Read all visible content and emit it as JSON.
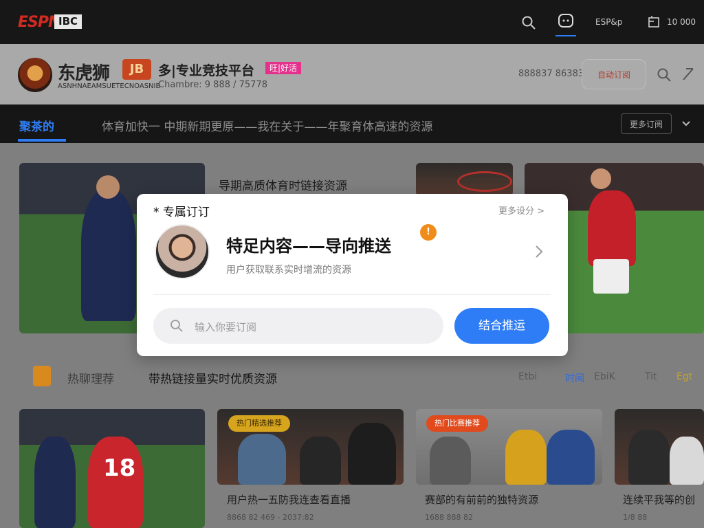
{
  "topbar": {
    "logo_espn": "ESPN",
    "logo_box": "IBC",
    "user_text": "ESP&p",
    "cart_count": "10 000",
    "icons": [
      "search-icon",
      "chat-icon",
      "bag-icon"
    ]
  },
  "brand": {
    "name": "东虎狮",
    "badge": "JB",
    "sub": "ASNHNAEAMSUETECNOASNIB",
    "slogan": "多|专业竞技平台",
    "tag": "旺|好活",
    "stats": "Chambre: 9   888 / 75778",
    "number": "888837 86383",
    "follow_label": "自动订阅"
  },
  "nav": {
    "active": "聚茶的",
    "ticker": "体育加快一  中期新期更原——我在关于——年聚育体高速的资源",
    "more_label": "更多订阅"
  },
  "feature": {
    "title": "导期高质体育时链接资源"
  },
  "section": {
    "label": "热聊理荐",
    "title": "带热链接量实时优质资源",
    "filters": [
      "Etbi",
      "时间",
      "EbiK",
      "Tit",
      "Egt"
    ]
  },
  "thumbs": [
    {
      "chip": "",
      "title": "",
      "meta": ""
    },
    {
      "chip": "热门精选推荐",
      "title": "用户热一五防我连查看直播",
      "meta": "8868 82      469 - 2037:82"
    },
    {
      "chip": "热门比赛推荐",
      "title": "赛部的有前前的独特资源",
      "meta": "1688 888 82"
    },
    {
      "chip": "",
      "title": "连续平我等的创",
      "meta": "1/8 88"
    }
  ],
  "popup": {
    "title": "* 专属订订",
    "more": "更多设分 >",
    "headline": "特足内容——导向推送",
    "dot": "!",
    "desc": "用户获取联系实时增流的资源",
    "search_placeholder": "输入你要订阅",
    "button_label": "结合推运"
  },
  "colors": {
    "accent": "#2e7cf6",
    "brand_red": "#d12b22",
    "tag_pink": "#e3318c",
    "dot_orange": "#f08c1a"
  }
}
